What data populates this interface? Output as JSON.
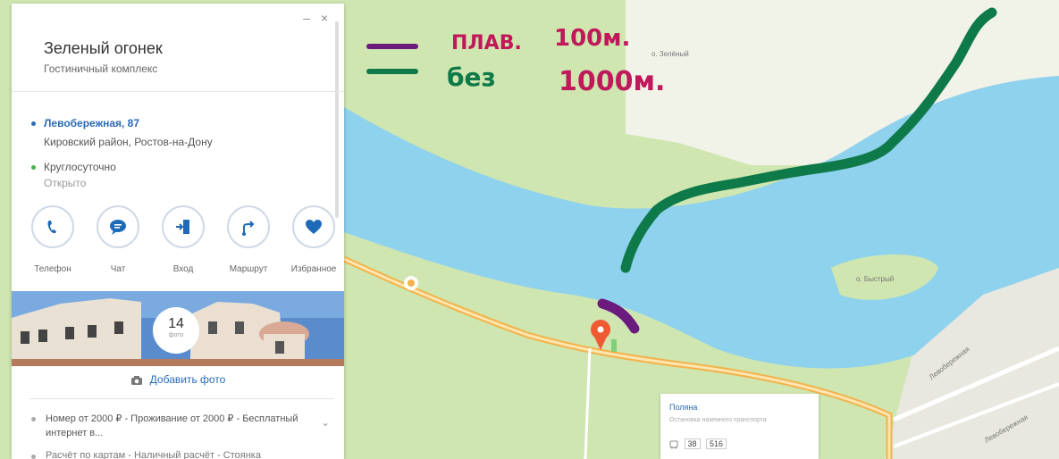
{
  "place": {
    "title": "Зеленый огонек",
    "subtitle": "Гостиничный комплекс",
    "address": "Левобережная, 87",
    "district": "Кировский район, Ростов-на-Дону",
    "hours": "Круглосуточно",
    "status": "Открыто",
    "window_controls": "– ×"
  },
  "actions": [
    {
      "label": "Телефон",
      "icon": "phone-icon"
    },
    {
      "label": "Чат",
      "icon": "chat-icon"
    },
    {
      "label": "Вход",
      "icon": "entrance-icon"
    },
    {
      "label": "Маршрут",
      "icon": "route-icon"
    },
    {
      "label": "Избранное",
      "icon": "heart-icon"
    }
  ],
  "photos": {
    "count": "14",
    "caption": "фото",
    "add_label": "Добавить фото"
  },
  "amenities": {
    "line1": "Номер от 2000 ₽ - Проживание от 2000 ₽ - Бесплатный интернет в...",
    "line2": "Расчёт по картам - Наличный расчёт - Стоянка"
  },
  "map_labels": {
    "zeleny": "о. Зелёный",
    "bystry": "о. Быстрый",
    "street": "Левобережная",
    "street2": "Левобережная"
  },
  "transit_stop": {
    "name": "Поляна",
    "type": "Остановка наземного транспорта",
    "routes": [
      "38",
      "516"
    ]
  },
  "annotations": {
    "purple_label": "ПЛАВ.",
    "purple_value": "100м.",
    "green_label": "без",
    "green_value": "1000м."
  },
  "colors": {
    "water": "#8fd2ee",
    "land": "#cfe6b0",
    "road": "#f3b24a",
    "purple": "#6b1a7e",
    "green": "#0e7a49",
    "magenta": "#c0185a",
    "accent": "#1e6ab8"
  }
}
